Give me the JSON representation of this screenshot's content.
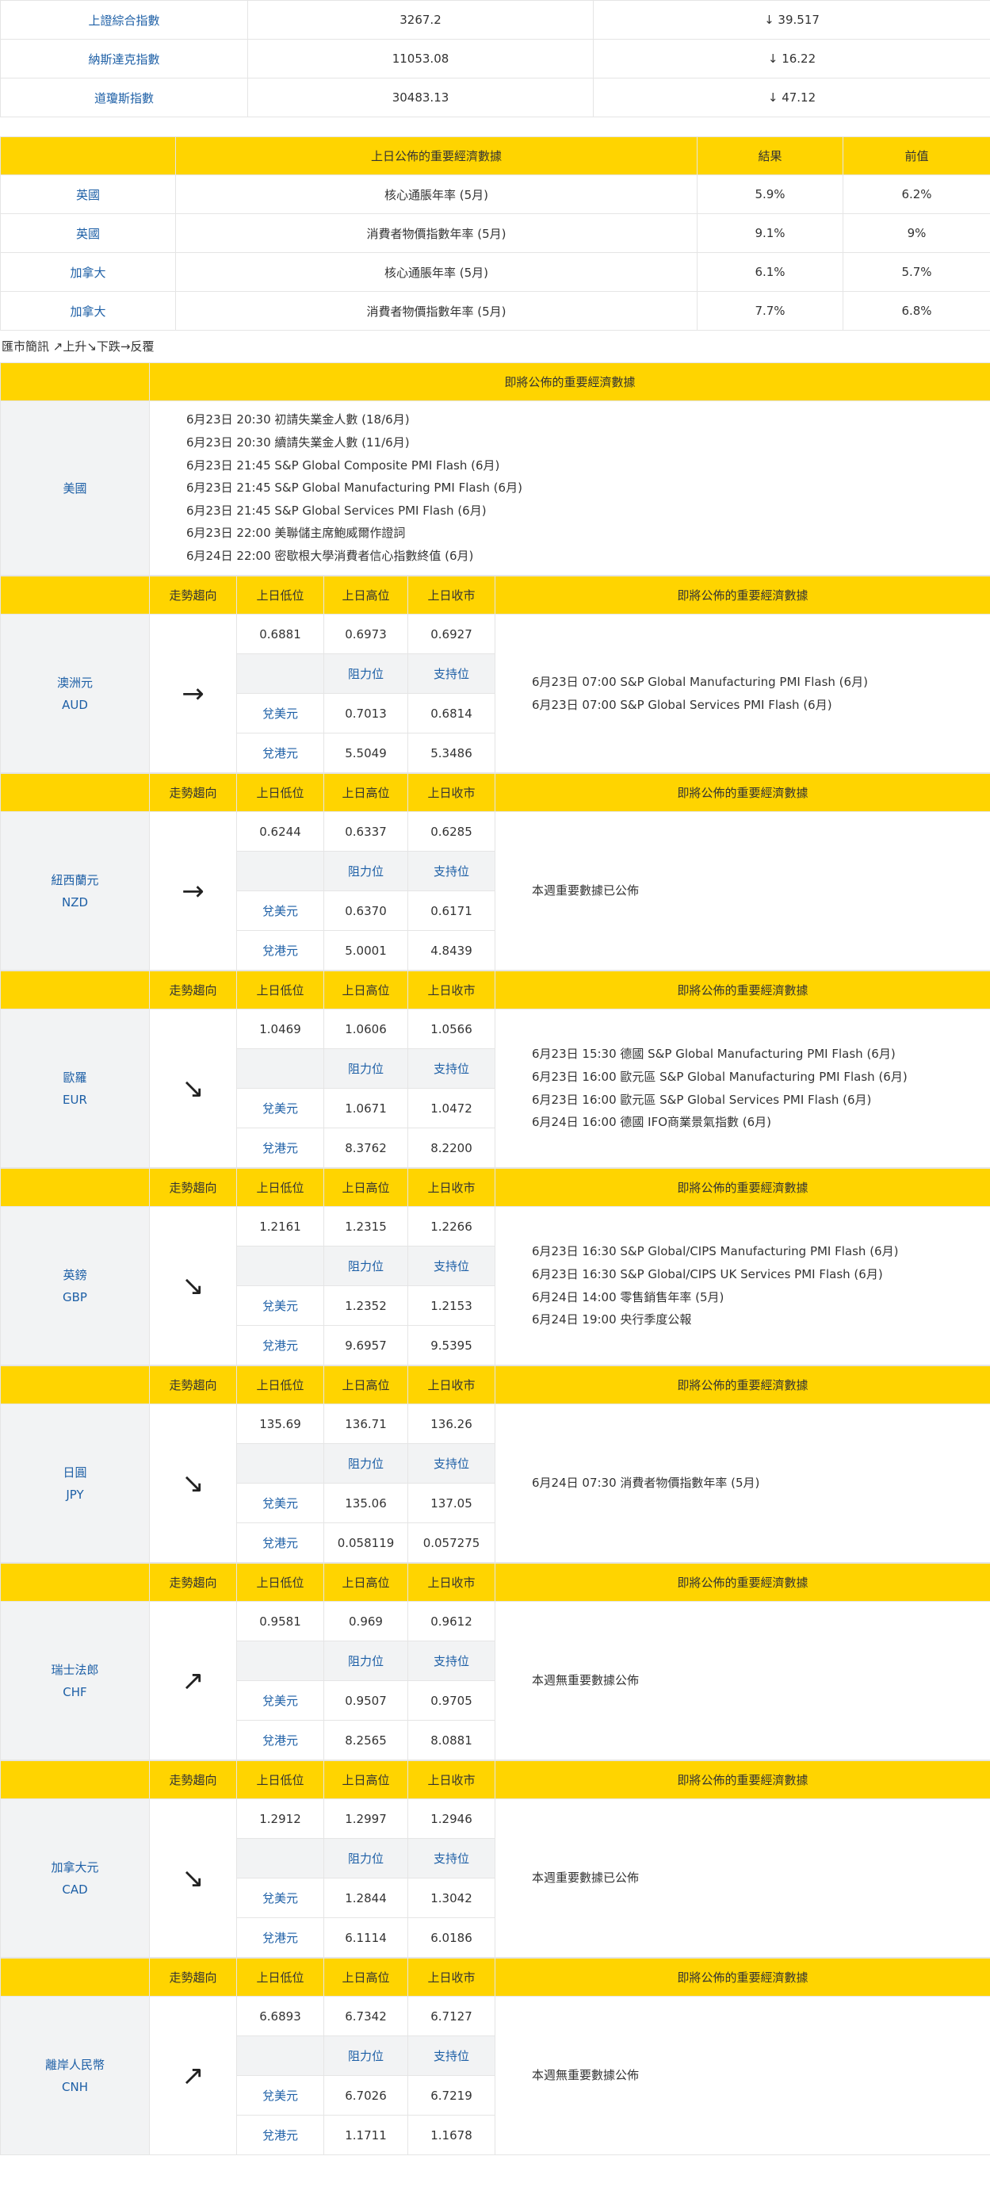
{
  "indices": [
    {
      "name": "上證綜合指數",
      "value": "3267.2",
      "change": "↓ 39.517"
    },
    {
      "name": "納斯達克指數",
      "value": "11053.08",
      "change": "↓ 16.22"
    },
    {
      "name": "道瓊斯指數",
      "value": "30483.13",
      "change": "↓ 47.12"
    }
  ],
  "econ_table": {
    "headers": {
      "country": "",
      "title": "上日公佈的重要經濟數據",
      "result": "結果",
      "previous": "前值"
    },
    "rows": [
      {
        "country": "英國",
        "item": "核心通脹年率 (5月)",
        "result": "5.9%",
        "previous": "6.2%"
      },
      {
        "country": "英國",
        "item": "消費者物價指數年率 (5月)",
        "result": "9.1%",
        "previous": "9%"
      },
      {
        "country": "加拿大",
        "item": "核心通脹年率 (5月)",
        "result": "6.1%",
        "previous": "5.7%"
      },
      {
        "country": "加拿大",
        "item": "消費者物價指數年率 (5月)",
        "result": "7.7%",
        "previous": "6.8%"
      }
    ]
  },
  "legend_note": "匯市簡訊 ↗上升↘下跌→反覆",
  "us_block": {
    "header": "即將公佈的重要經濟數據",
    "country": "美國",
    "events": [
      "6月23日 20:30  初請失業金人數 (18/6月)",
      "6月23日 20:30  續請失業金人數 (11/6月)",
      "6月23日 21:45  S&P Global Composite PMI Flash (6月)",
      "6月23日 21:45  S&P Global Manufacturing PMI Flash (6月)",
      "6月23日 21:45  S&P Global Services PMI Flash (6月)",
      "6月23日 22:00  美聯儲主席鮑威爾作證詞",
      "6月24日 22:00  密歇根大學消費者信心指數終值 (6月)"
    ]
  },
  "currency_headers": {
    "trend": "走勢趨向",
    "low": "上日低位",
    "high": "上日高位",
    "close": "上日收市",
    "resistance": "阻力位",
    "support": "支持位",
    "vs_usd": "兌美元",
    "vs_hkd": "兌港元",
    "events_title": "即將公佈的重要經濟數據"
  },
  "currencies": [
    {
      "name": "澳洲元",
      "code": "AUD",
      "trend": "→",
      "low": "0.6881",
      "high": "0.6973",
      "close": "0.6927",
      "usd_res": "0.7013",
      "usd_sup": "0.6814",
      "hkd_res": "5.5049",
      "hkd_sup": "5.3486",
      "events": [
        "6月23日 07:00   S&P Global Manufacturing PMI Flash (6月)",
        "6月23日 07:00  S&P Global Services PMI Flash (6月)"
      ]
    },
    {
      "name": "紐西蘭元",
      "code": "NZD",
      "trend": "→",
      "low": "0.6244",
      "high": "0.6337",
      "close": "0.6285",
      "usd_res": "0.6370",
      "usd_sup": "0.6171",
      "hkd_res": "5.0001",
      "hkd_sup": "4.8439",
      "events": [
        "本週重要數據已公佈"
      ]
    },
    {
      "name": "歐羅",
      "code": "EUR",
      "trend": "↘",
      "low": "1.0469",
      "high": "1.0606",
      "close": "1.0566",
      "usd_res": "1.0671",
      "usd_sup": "1.0472",
      "hkd_res": "8.3762",
      "hkd_sup": "8.2200",
      "events": [
        "6月23日 15:30  德國 S&P Global Manufacturing PMI Flash (6月)",
        "6月23日 16:00  歐元區 S&P Global Manufacturing PMI Flash (6月)",
        "6月23日 16:00  歐元區 S&P Global Services PMI Flash (6月)",
        "6月24日 16:00  德國 IFO商業景氣指數 (6月)"
      ]
    },
    {
      "name": "英鎊",
      "code": "GBP",
      "trend": "↘",
      "low": "1.2161",
      "high": "1.2315",
      "close": "1.2266",
      "usd_res": "1.2352",
      "usd_sup": "1.2153",
      "hkd_res": "9.6957",
      "hkd_sup": "9.5395",
      "events": [
        "6月23日 16:30  S&P Global/CIPS Manufacturing PMI Flash (6月)",
        "6月23日 16:30  S&P Global/CIPS UK Services PMI Flash (6月)",
        "6月24日 14:00  零售銷售年率 (5月)",
        "6月24日 19:00  央行季度公報"
      ]
    },
    {
      "name": "日圓",
      "code": "JPY",
      "trend": "↘",
      "low": "135.69",
      "high": "136.71",
      "close": "136.26",
      "usd_res": "135.06",
      "usd_sup": "137.05",
      "hkd_res": "0.058119",
      "hkd_sup": "0.057275",
      "events": [
        "6月24日 07:30  消費者物價指數年率 (5月)"
      ]
    },
    {
      "name": "瑞士法郎",
      "code": "CHF",
      "trend": "↗",
      "low": "0.9581",
      "high": "0.969",
      "close": "0.9612",
      "usd_res": "0.9507",
      "usd_sup": "0.9705",
      "hkd_res": "8.2565",
      "hkd_sup": "8.0881",
      "events": [
        "本週無重要數據公佈"
      ]
    },
    {
      "name": "加拿大元",
      "code": "CAD",
      "trend": "↘",
      "low": "1.2912",
      "high": "1.2997",
      "close": "1.2946",
      "usd_res": "1.2844",
      "usd_sup": "1.3042",
      "hkd_res": "6.1114",
      "hkd_sup": "6.0186",
      "events": [
        "本週重要數據已公佈"
      ]
    },
    {
      "name": "離岸人民幣",
      "code": "CNH",
      "trend": "↗",
      "low": "6.6893",
      "high": "6.7342",
      "close": "6.7127",
      "usd_res": "6.7026",
      "usd_sup": "6.7219",
      "hkd_res": "1.1711",
      "hkd_sup": "1.1678",
      "events": [
        "本週無重要數據公佈"
      ]
    }
  ],
  "colors": {
    "header_bg": "#ffd400",
    "link_blue": "#1d5fa6",
    "gray_bg": "#f2f3f4",
    "border": "#e5e5e5"
  }
}
